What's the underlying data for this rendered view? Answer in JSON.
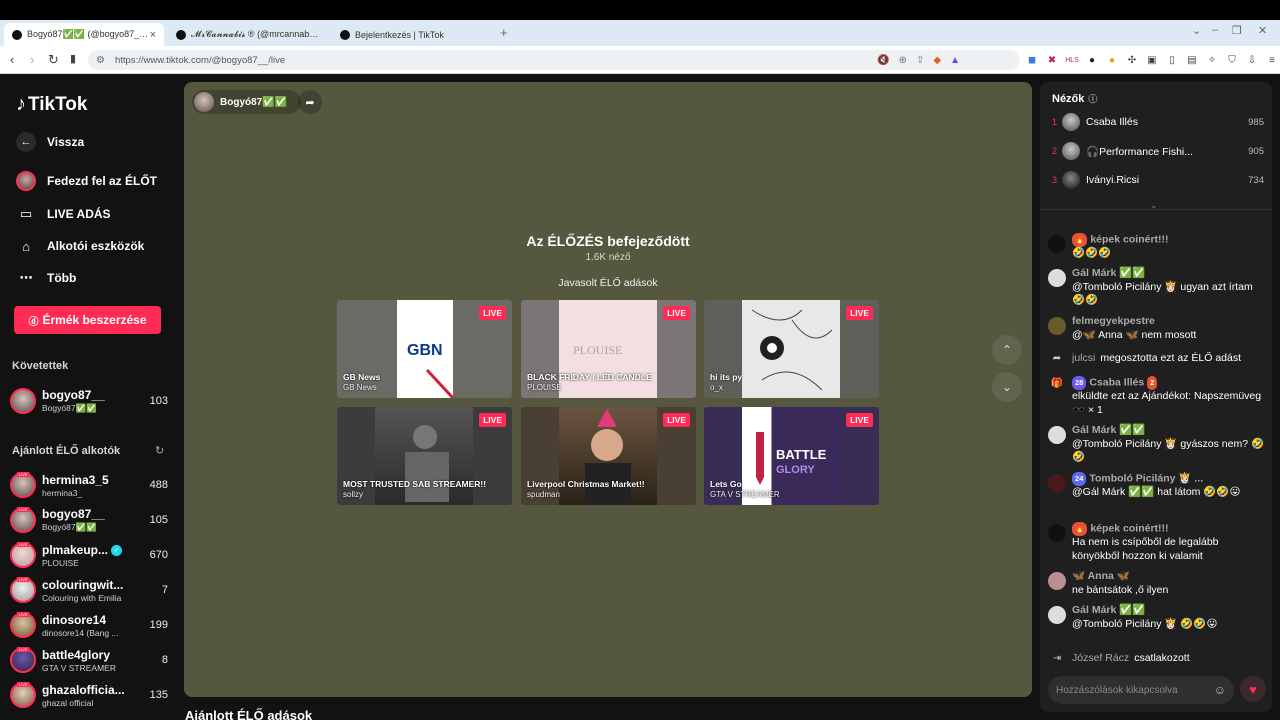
{
  "browser": {
    "tabs": [
      {
        "title": "Bogyó87✅✅ (@bogyo87_) É…",
        "close": "×"
      },
      {
        "title": "𝓜𝓻𝓒𝓪𝓷𝓷𝓪𝓫𝓲𝓼 ® (@mrcannabis_)",
        "close": ""
      },
      {
        "title": "Bejelentkezés | TikTok",
        "close": ""
      }
    ],
    "new_tab": "+",
    "url": "https://www.tiktok.com/@bogyo87__/live",
    "window_controls": [
      "⌄",
      "–",
      "❐",
      "✕"
    ]
  },
  "sidebar": {
    "logo": "TikTok",
    "nav": [
      {
        "label": "Vissza",
        "icon": "back-arrow-icon"
      },
      {
        "label": "Fedezd fel az ÉLŐT",
        "icon": "avatar-icon"
      },
      {
        "label": "LIVE ADÁS",
        "icon": "camera-icon"
      },
      {
        "label": "Alkotói eszközök",
        "icon": "lightbulb-icon"
      },
      {
        "label": "Több",
        "icon": "more-icon"
      }
    ],
    "coins_button": "Érmék beszerzése",
    "following_header": "Követettek",
    "following": [
      {
        "name": "bogyo87__",
        "sub": "Bogyó87✅✅",
        "count": "103"
      }
    ],
    "recommended_header": "Ajánlott ÉLŐ alkotók",
    "recommended": [
      {
        "name": "hermina3_5",
        "sub": "hermina3_",
        "count": "488"
      },
      {
        "name": "bogyo87__",
        "sub": "Bogyó87✅✅",
        "count": "105"
      },
      {
        "name": "plmakeup...",
        "sub": "PLOUISE",
        "count": "670",
        "verified": true
      },
      {
        "name": "colouringwit...",
        "sub": "Colouring with Emilia",
        "count": "7"
      },
      {
        "name": "dinosore14",
        "sub": "dinosore14 (Bang ...",
        "count": "199"
      },
      {
        "name": "battle4glory",
        "sub": "GTA V STREAMER",
        "count": "8"
      },
      {
        "name": "ghazalofficia...",
        "sub": "ghazal official",
        "count": "135"
      }
    ]
  },
  "player": {
    "host_name": "Bogyó87✅✅",
    "ended_title": "Az ÉLŐZÉS befejeződött",
    "viewers": "1.6K néző",
    "suggested_header": "Javasolt ÉLŐ adások",
    "live_label": "LIVE",
    "cards": [
      {
        "title": "GB News",
        "sub": "GB News",
        "thumb_color": "#ffffff",
        "bg": "#6e6e6e"
      },
      {
        "title": "BLACK FRIDAY | LED CANDLE",
        "sub": "PLOUISE",
        "thumb_color": "#f3dfe1",
        "bg": "#7a7676"
      },
      {
        "title": "hi its py",
        "sub": "o_x",
        "thumb_color": "#e8e8e8",
        "bg": "#5f5f5a"
      },
      {
        "title": "MOST TRUSTED SAB STREAMER!!",
        "sub": "sollzy",
        "thumb_color": "#4a4a4a",
        "bg": "#3c3c3c"
      },
      {
        "title": "Liverpool Christmas Market!!",
        "sub": "spudman",
        "thumb_color": "#8a6c4a",
        "bg": "#4a3f33"
      },
      {
        "title": "Lets Go",
        "sub": "GTA V STREAMER",
        "thumb_color": "#3a2a5a",
        "bg": "#3a2d55"
      }
    ],
    "arrow_up": "⌃",
    "arrow_down": "⌄"
  },
  "bottom_header": "Ajánlott ÉLŐ adások",
  "chat": {
    "viewers_header": "Nézők",
    "top_viewers": [
      {
        "rank": "1",
        "name": "Csaba Illés",
        "score": "985"
      },
      {
        "rank": "2",
        "name": "🎧Performance Fishi...",
        "score": "905"
      },
      {
        "rank": "3",
        "name": "Iványi.Ricsi",
        "score": "734"
      }
    ],
    "messages": [
      {
        "name": "",
        "badge": "🔥",
        "badge2": "képek coinért!!!",
        "text": "🤣🤣🤣"
      },
      {
        "name": "Gál Márk ✅✅",
        "badge": "",
        "badge2": "",
        "text": "@Tomboló Picilány 👸🏻 ugyan azt írtam 🤣🤣"
      },
      {
        "name": "felmegyekpestre",
        "badge": "",
        "badge2": "",
        "text": "@🦋 Anna 🦋 nem mosott"
      },
      {
        "name": "Gál Márk ✅✅",
        "badge": "",
        "badge2": "",
        "text": "@Tomboló Picilány 👸🏻 gyászos nem? 🤣🤣"
      },
      {
        "name": "Tomboló Picilány 👸🏻 ...",
        "badge": "24",
        "badge2": "",
        "text": "@Gál Márk ✅✅ hat látom 🤣🤣😛"
      },
      {
        "name": "képek coinért!!!",
        "badge": "",
        "badge2": "",
        "text": "Ha nem is csípőből de legalább könyökből hozzon ki valamit"
      },
      {
        "name": "🦋 Anna 🦋",
        "badge": "",
        "badge2": "",
        "text": "ne bántsátok ,ő ilyen"
      },
      {
        "name": "Gál Márk ✅✅",
        "badge": "",
        "badge2": "",
        "text": "@Tomboló Picilány 👸🏻 🤣🤣😛"
      }
    ],
    "share_event": {
      "name": "julcsi",
      "text": "megosztotta ezt az ÉLŐ adást"
    },
    "gift_event": {
      "name": "Csaba Illés",
      "badge": "28",
      "badge_b": "2",
      "text": "elküldte ezt az Ajándékot: Napszemüveg 🕶️ × 1"
    },
    "join_event": {
      "name": "József Rácz",
      "text": "csatlakozott"
    },
    "input_placeholder": "Hozzászólások kikapcsolva"
  },
  "colors": {
    "accent": "#fe2c55",
    "player_bg": "#56573f",
    "sidebar_bg": "#121212",
    "chat_bg": "#1f1f1f"
  }
}
